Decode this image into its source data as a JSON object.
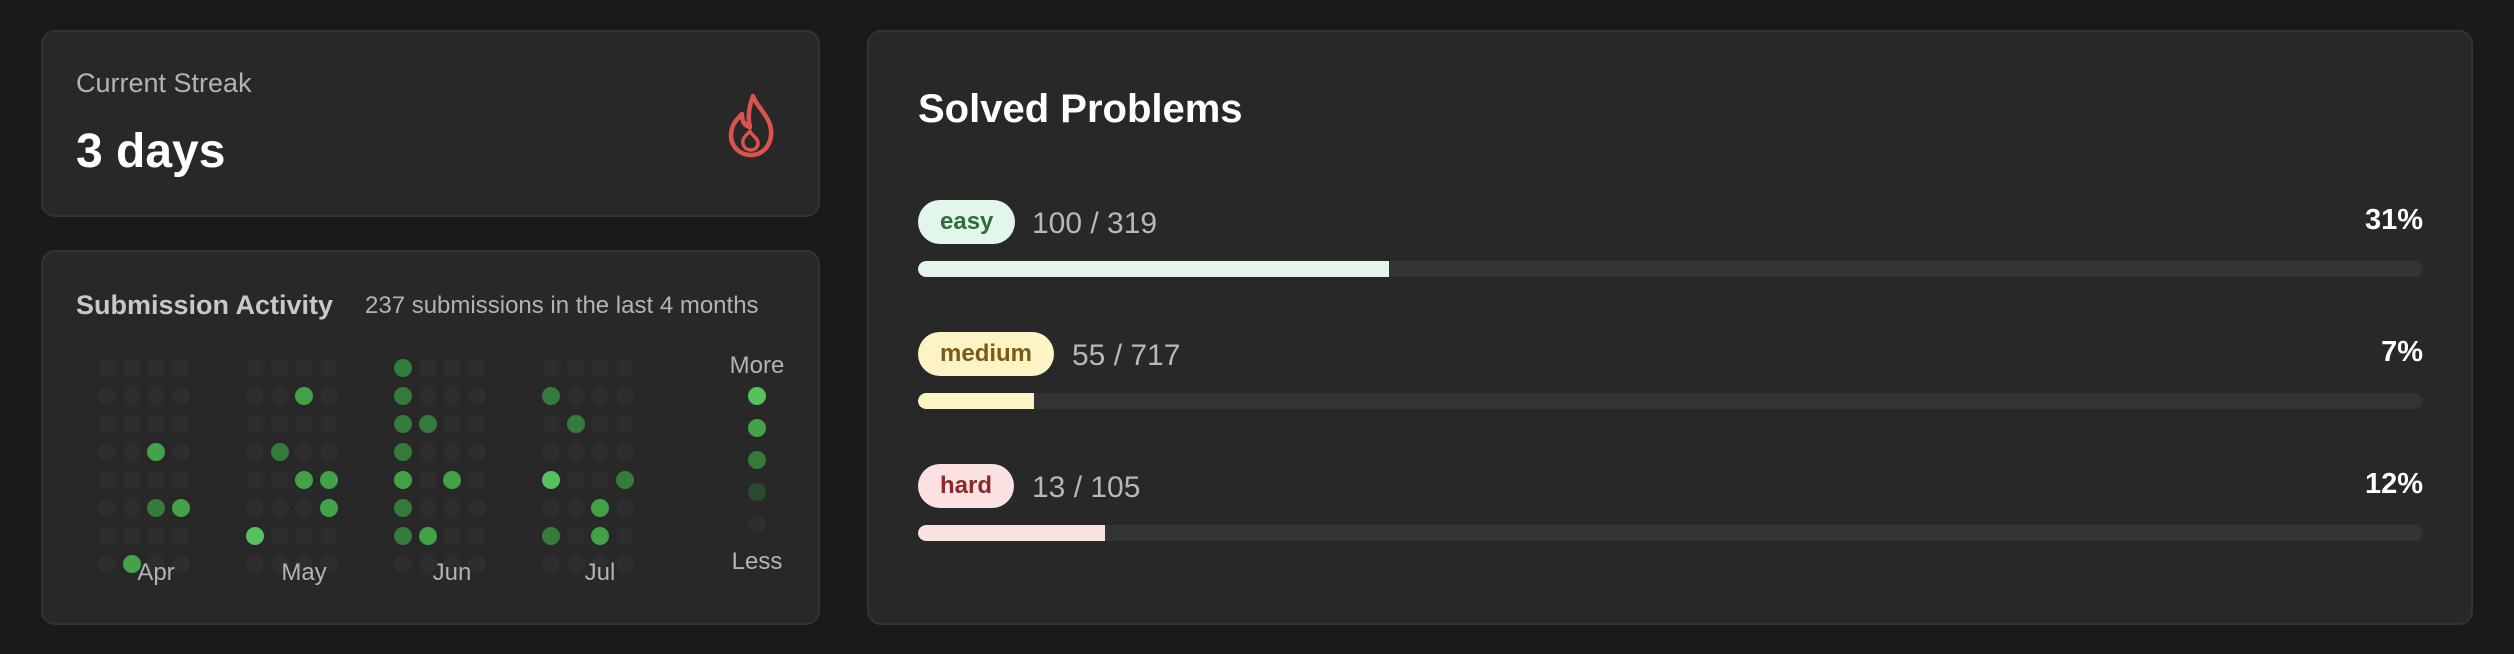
{
  "streak": {
    "label": "Current Streak",
    "value": "3 days",
    "icon": "flame-icon",
    "icon_color": "#d9534f"
  },
  "activity": {
    "title": "Submission Activity",
    "subtitle": "237 submissions in the last 4 months",
    "months": [
      "Apr",
      "May",
      "Jun",
      "Jul"
    ],
    "legend_more": "More",
    "legend_less": "Less",
    "level_colors": [
      "#2e2e2e",
      "#2a4a2f",
      "#357c3c",
      "#43a148",
      "#57c15d"
    ],
    "month_grids": [
      [
        [
          0,
          0,
          0,
          0
        ],
        [
          0,
          0,
          0,
          0
        ],
        [
          0,
          0,
          0,
          0
        ],
        [
          0,
          0,
          3,
          0
        ],
        [
          0,
          0,
          0,
          0
        ],
        [
          0,
          0,
          2,
          3
        ],
        [
          0,
          0,
          0,
          0
        ],
        [
          0,
          3,
          0,
          0
        ]
      ],
      [
        [
          0,
          0,
          0,
          0
        ],
        [
          0,
          0,
          3,
          0
        ],
        [
          0,
          0,
          0,
          0
        ],
        [
          0,
          2,
          0,
          0
        ],
        [
          0,
          0,
          3,
          3
        ],
        [
          0,
          0,
          0,
          3
        ],
        [
          4,
          0,
          0,
          0
        ],
        [
          0,
          0,
          0,
          0
        ]
      ],
      [
        [
          2,
          0,
          0,
          0
        ],
        [
          2,
          0,
          0,
          0
        ],
        [
          2,
          2,
          0,
          0
        ],
        [
          2,
          0,
          0,
          0
        ],
        [
          3,
          0,
          3,
          0
        ],
        [
          2,
          0,
          0,
          0
        ],
        [
          2,
          3,
          0,
          0
        ],
        [
          0,
          0,
          0,
          0
        ]
      ],
      [
        [
          0,
          0,
          0,
          0
        ],
        [
          2,
          0,
          0,
          0
        ],
        [
          0,
          2,
          0,
          0
        ],
        [
          0,
          0,
          0,
          0
        ],
        [
          4,
          0,
          0,
          2
        ],
        [
          0,
          0,
          3,
          0
        ],
        [
          2,
          0,
          3,
          0
        ],
        [
          0,
          0,
          0,
          0
        ]
      ]
    ]
  },
  "solved": {
    "title": "Solved Problems",
    "rows": [
      {
        "label": "easy",
        "solved": 100,
        "total": 319,
        "count_text": "100 / 319",
        "percent_text": "31%",
        "ratio": 0.313,
        "badge_bg": "#e2f7ea",
        "badge_fg": "#2e6b3f",
        "bar_color": "#e2f7ea"
      },
      {
        "label": "medium",
        "solved": 55,
        "total": 717,
        "count_text": "55 / 717",
        "percent_text": "7%",
        "ratio": 0.077,
        "badge_bg": "#fcf4c4",
        "badge_fg": "#7a5a18",
        "bar_color": "#fcf4c4"
      },
      {
        "label": "hard",
        "solved": 13,
        "total": 105,
        "count_text": "13 / 105",
        "percent_text": "12%",
        "ratio": 0.124,
        "badge_bg": "#fbe1e1",
        "badge_fg": "#8a2b2b",
        "bar_color": "#fbe1e1"
      }
    ]
  }
}
